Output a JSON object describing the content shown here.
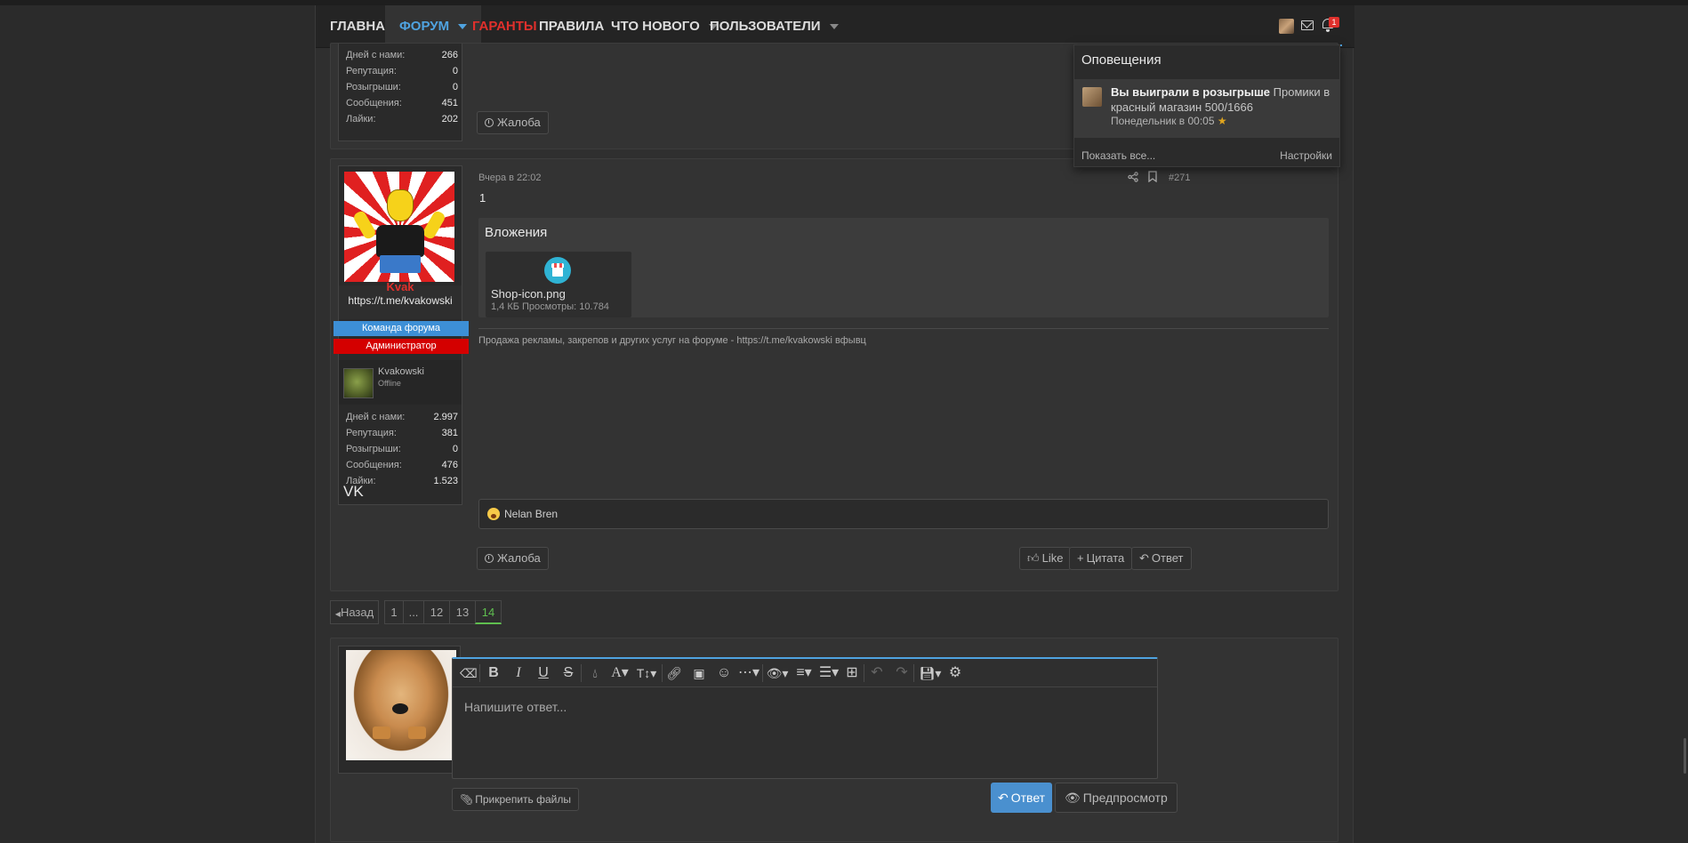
{
  "nav": {
    "items": [
      {
        "label": "ГЛАВНАЯ"
      },
      {
        "label": "ФОРУМ"
      },
      {
        "label": "ГАРАНТЫ"
      },
      {
        "label": "ПРАВИЛА"
      },
      {
        "label": "ЧТО НОВОГО"
      },
      {
        "label": "ПОЛЬЗОВАТЕЛИ"
      }
    ],
    "bell_count": "1"
  },
  "prev_post": {
    "stats": [
      {
        "label": "Дней с нами:",
        "value": "266"
      },
      {
        "label": "Репутация:",
        "value": "0"
      },
      {
        "label": "Розыгрыши:",
        "value": "0"
      },
      {
        "label": "Сообщения:",
        "value": "451"
      },
      {
        "label": "Лайки:",
        "value": "202"
      }
    ],
    "report_label": "Жалоба"
  },
  "post": {
    "date": "Вчера в 22:02",
    "number": "#271",
    "body": "1",
    "attachments_title": "Вложения",
    "file": {
      "name": "Shop-icon.png",
      "meta": "1,4 КБ Просмотры: 10.784"
    },
    "signature": "Продажа рекламы, закрепов и других услуг на форуме - https://t.me/kvakowski вфывц",
    "reaction_user": "Nelan Bren",
    "report_label": "Жалоба",
    "like_label": "Like",
    "quote_label": "Цитата",
    "reply_label": "Ответ",
    "user": {
      "name": "Kvak",
      "title_line": "https://t.me/kvakowski",
      "banner1": "Команда форума",
      "banner2": "Администратор",
      "linked_name": "Kvakowski",
      "linked_status": "Offline",
      "stats": [
        {
          "label": "Дней с нами:",
          "value": "2.997"
        },
        {
          "label": "Репутация:",
          "value": "381"
        },
        {
          "label": "Розыгрыши:",
          "value": "0"
        },
        {
          "label": "Сообщения:",
          "value": "476"
        },
        {
          "label": "Лайки:",
          "value": "1.523"
        }
      ],
      "vk": "VK"
    }
  },
  "pagination": {
    "prev": "Назад",
    "pages": [
      "1",
      "...",
      "12",
      "13",
      "14"
    ]
  },
  "reply": {
    "placeholder": "Напишите ответ...",
    "attach_label": "Прикрепить файлы",
    "submit_label": "Ответ",
    "preview_label": "Предпросмотр"
  },
  "notifications": {
    "title": "Оповещения",
    "item_bold": "Вы выиграли в розыгрыше",
    "item_rest": "Промики в красный магазин 500/1666",
    "item_time": "Понедельник в 00:05",
    "show_all": "Показать все...",
    "settings": "Настройки"
  },
  "colors": {
    "accent": "#4fa3e0",
    "red": "#e0302c",
    "green": "#5fbf4f",
    "team_banner": "#3d8fd6",
    "admin_banner": "#d40000"
  }
}
